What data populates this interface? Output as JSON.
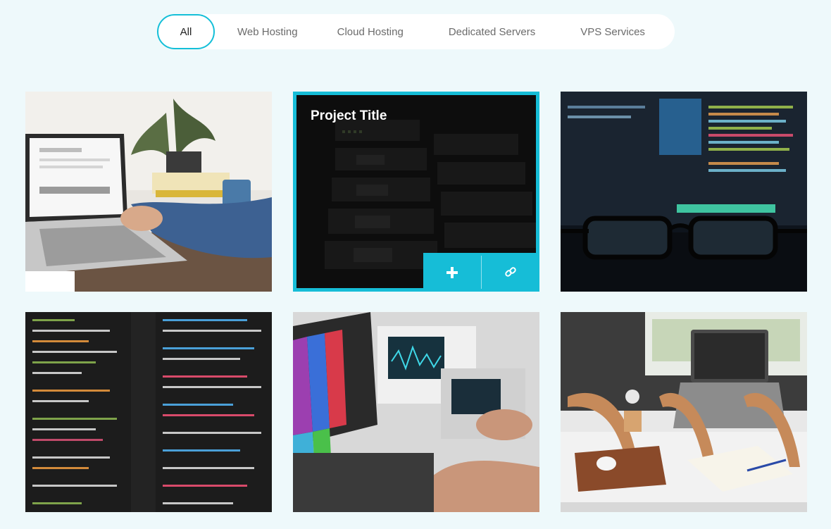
{
  "filters": [
    {
      "label": "All",
      "active": true
    },
    {
      "label": "Web Hosting",
      "active": false
    },
    {
      "label": "Cloud Hosting",
      "active": false
    },
    {
      "label": "Dedicated Servers",
      "active": false
    },
    {
      "label": "VPS Services",
      "active": false
    }
  ],
  "portfolio": {
    "hover_item": {
      "title": "Project Title",
      "actions": [
        {
          "icon": "plus-icon"
        },
        {
          "icon": "link-icon"
        }
      ]
    },
    "items": [
      {
        "image": "laptop-workspace-image"
      },
      {
        "image": "server-rack-image"
      },
      {
        "image": "code-monitors-glasses-image"
      },
      {
        "image": "code-editor-image"
      },
      {
        "image": "oscilloscope-electronics-image"
      },
      {
        "image": "laptop-desk-image"
      }
    ]
  },
  "colors": {
    "accent": "#16bdd7",
    "page_background": "#eef9fb",
    "filter_background": "#ffffff"
  }
}
